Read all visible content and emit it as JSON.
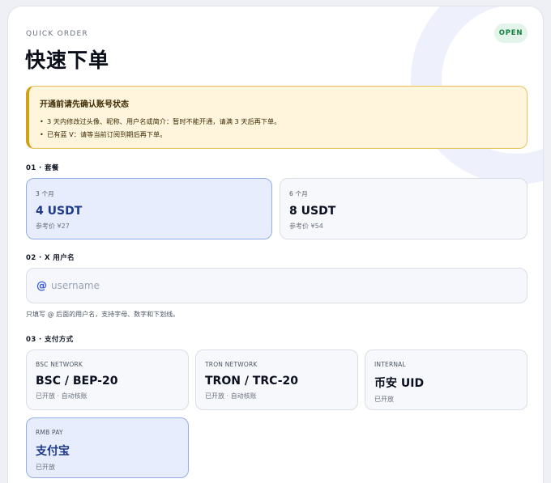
{
  "header": {
    "eyebrow": "QUICK ORDER",
    "title": "快速下单",
    "status": "OPEN"
  },
  "notice": {
    "title": "开通前请先确认账号状态",
    "items": [
      "3 天内修改过头像、昵称、用户名或简介：暂时不能开通，请满 3 天后再下单。",
      "已有蓝 V：请等当前订阅到期后再下单。"
    ]
  },
  "plan_section": {
    "label": "01 · 套餐",
    "options": [
      {
        "period": "3 个月",
        "price": "4 USDT",
        "reference": "参考价 ¥27",
        "selected": true
      },
      {
        "period": "6 个月",
        "price": "8 USDT",
        "reference": "参考价 ¥54",
        "selected": false
      }
    ]
  },
  "username_section": {
    "label": "02 · X 用户名",
    "prefix": "@",
    "value": "",
    "placeholder": "username",
    "hint": "只填写 @ 后面的用户名，支持字母、数字和下划线。"
  },
  "payment_section": {
    "label": "03 · 支付方式",
    "options": [
      {
        "network": "BSC NETWORK",
        "name": "BSC / BEP-20",
        "status": "已开放 · 自动核账",
        "selected": false
      },
      {
        "network": "TRON NETWORK",
        "name": "TRON / TRC-20",
        "status": "已开放 · 自动核账",
        "selected": false
      },
      {
        "network": "INTERNAL",
        "name": "币安 UID",
        "status": "已开放",
        "selected": false
      },
      {
        "network": "RMB PAY",
        "name": "支付宝",
        "status": "已开放",
        "selected": true
      }
    ]
  },
  "colors": {
    "accent": "#3b5bdb",
    "selected_bg": "#e7edfc",
    "notice_bg": "#fef5dc",
    "notice_border": "#d4a017",
    "status_green": "#15803d"
  }
}
